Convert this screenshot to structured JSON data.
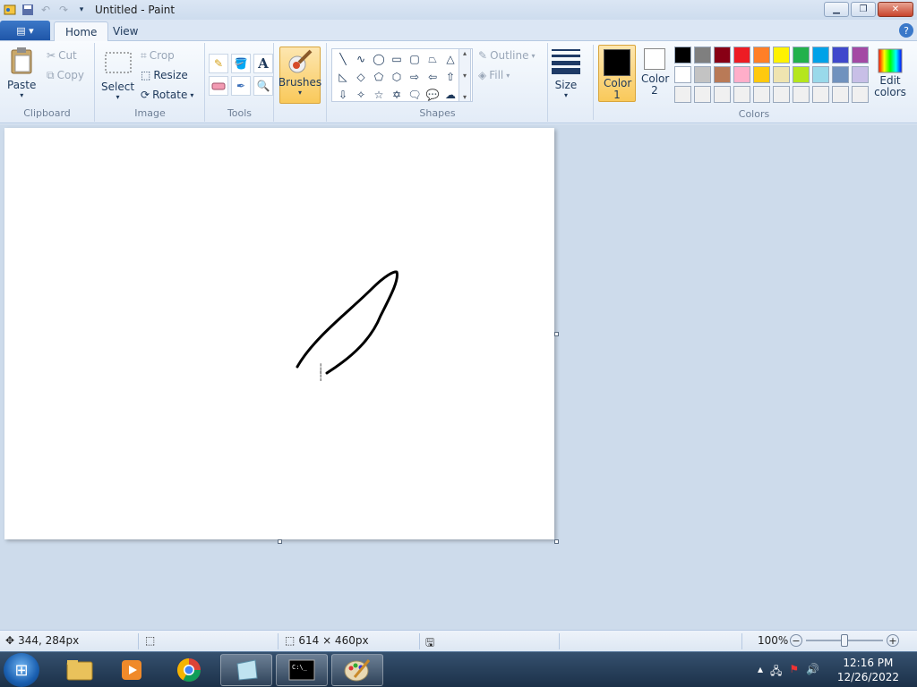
{
  "window": {
    "title": "Untitled - Paint"
  },
  "tabs": [
    {
      "label": "Home"
    },
    {
      "label": "View"
    }
  ],
  "ribbon": {
    "clipboard": {
      "label": "Clipboard",
      "paste": "Paste",
      "cut": "Cut",
      "copy": "Copy"
    },
    "image": {
      "label": "Image",
      "select": "Select",
      "crop": "Crop",
      "resize": "Resize",
      "rotate": "Rotate"
    },
    "tools": {
      "label": "Tools"
    },
    "brushes": {
      "label": "Brushes"
    },
    "shapes": {
      "label": "Shapes",
      "outline": "Outline",
      "fill": "Fill"
    },
    "size": {
      "label": "Size"
    },
    "colors": {
      "label": "Colors",
      "color1": "Color 1",
      "color2": "Color 2",
      "edit": "Edit colors",
      "color1_value": "#000000",
      "color2_value": "#ffffff",
      "palette": [
        "#000000",
        "#7f7f7f",
        "#880015",
        "#ed1c24",
        "#ff7f27",
        "#fff200",
        "#22b14c",
        "#00a2e8",
        "#3f48cc",
        "#a349a4",
        "#ffffff",
        "#c3c3c3",
        "#b97a57",
        "#ffaec9",
        "#ffc90e",
        "#efe4b0",
        "#b5e61d",
        "#99d9ea",
        "#7092be",
        "#c8bfe7",
        "#f0f0f0",
        "#f0f0f0",
        "#f0f0f0",
        "#f0f0f0",
        "#f0f0f0",
        "#f0f0f0",
        "#f0f0f0",
        "#f0f0f0",
        "#f0f0f0",
        "#f0f0f0"
      ]
    }
  },
  "status": {
    "cursor": "344, 284px",
    "canvas_size": "614 × 460px",
    "zoom": "100%",
    "zoom_level": 1.0
  },
  "clock": {
    "time": "12:16 PM",
    "date": "12/26/2022"
  }
}
